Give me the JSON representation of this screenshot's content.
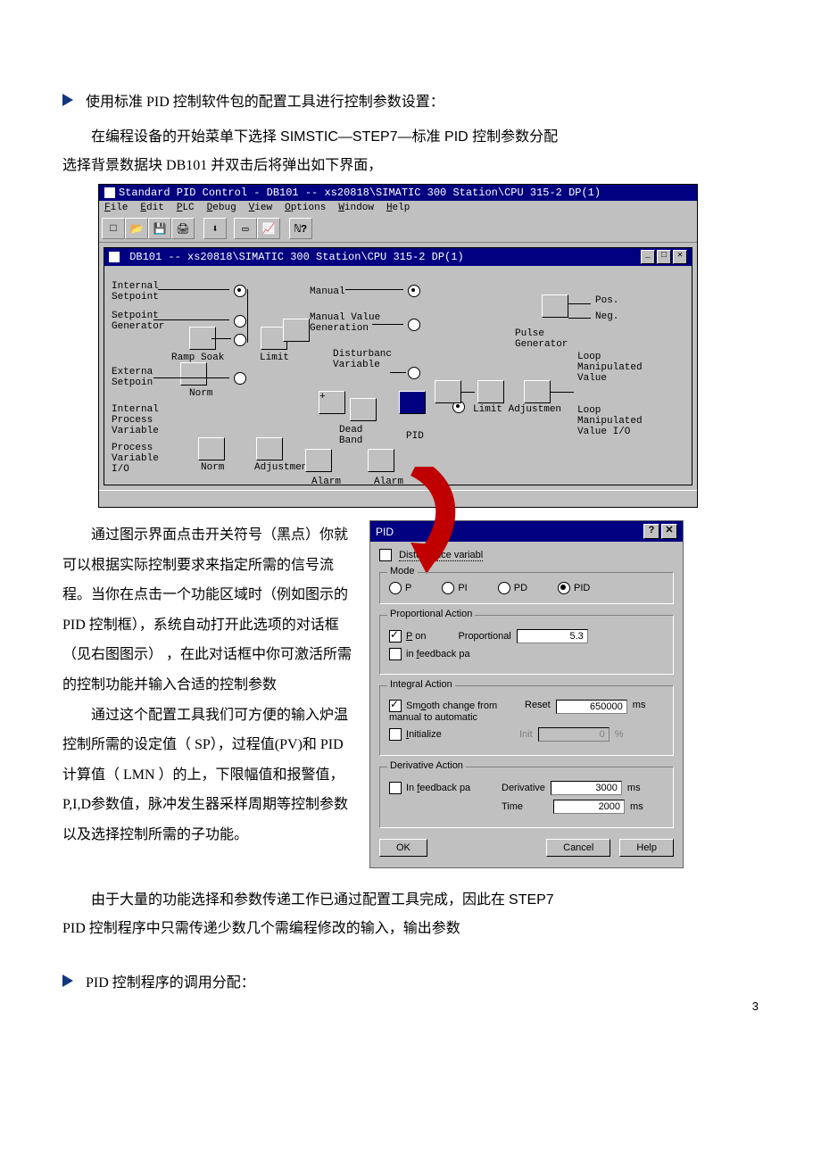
{
  "intro": {
    "bullet1": "使用标准 PID 控制软件包的配置工具进行控制参数设置：",
    "p1_a": "在编程设备的开始菜单下选择 ",
    "p1_b": "SIMSTIC—STEP7—标准 PID 控制参数分配",
    "p2_a": "选择背景数据块 ",
    "p2_b": "DB101 并双击后将弹出如下界面，"
  },
  "win": {
    "title_prefix": "Standard PID Control - DB101 -- xs20818\\SIMATIC 300 Station\\CPU 315-2 DP(1)",
    "menus": {
      "file": "File",
      "edit": "Edit",
      "plc": "PLC",
      "debug": "Debug",
      "view": "View",
      "options": "Options",
      "window": "Window",
      "help": "Help"
    },
    "inner_title": "DB101 -- xs20818\\SIMATIC 300 Station\\CPU 315-2 DP(1)",
    "labels": {
      "internal_setpoint": "Internal\nSetpoint",
      "setpoint_generator": "Setpoint\nGenerator",
      "ramp_soak": "Ramp Soak",
      "externa_setpoint": "Externa\nSetpoin",
      "norm": "Norm",
      "limit": "Limit",
      "manual": "Manual",
      "manual_value_gen": "Manual Value\nGeneration",
      "disturbance_variable": "Disturbanc\nVariable",
      "internal_pv": "Internal\nProcess\nVariable",
      "process_io": "Process\nVariable\nI/O",
      "adjustmen": "Adjustmen",
      "alarm": "Alarm",
      "dead_band": "Dead\nBand",
      "pid": "PID",
      "limit_adjustmen": "Limit Adjustmen",
      "pos": "Pos.",
      "neg": "Neg.",
      "pulse_generator": "Pulse\nGenerator",
      "loop_manip_value": "Loop\nManipulated\nValue",
      "loop_manip_io": "Loop\nManipulated\nValue I/O"
    }
  },
  "mid": {
    "p1": "通过图示界面点击开关符号（黑点）你就可以根据实际控制要求来指定所需的信号流程。当你在点击一个功能区域时（例如图示的 PID 控制框），系统自动打开此选项的对话框（见右图图示） ，在此对话框中你可激活所需的控制功能并输入合适的控制参数",
    "p2": "通过这个配置工具我们可方便的输入炉温控制所需的设定值（ SP），过程值(PV)和 PID 计算值（ LMN ）的上，下限幅值和报警值， P,I,D参数值，脉冲发生器采样周期等控制参数以及选择控制所需的子功能。"
  },
  "dlg": {
    "title": "PID",
    "disturbance": "Disturbance variabl",
    "mode_title": "Mode",
    "modes": {
      "p": "P",
      "pi": "PI",
      "pd": "PD",
      "pid": "PID"
    },
    "p_action_title": "Proportional Action",
    "p_on": "P on",
    "p_label": "Proportional",
    "p_value": "5.3",
    "p_feedback": "in feedback pa",
    "i_action_title": "Integral Action",
    "i_smooth": "Smooth change from manual to automatic",
    "i_reset": "Reset",
    "i_reset_value": "650000",
    "i_reset_unit": "ms",
    "i_initialize": "Initialize",
    "i_init": "Init",
    "i_init_value": "0",
    "i_init_unit": "%",
    "d_action_title": "Derivative Action",
    "d_feedback": "In feedback pa",
    "d_deriv": "Derivative",
    "d_deriv_value": "3000",
    "d_deriv_unit": "ms",
    "d_time": "Time",
    "d_time_value": "2000",
    "d_time_unit": "ms",
    "btn_ok": "OK",
    "btn_cancel": "Cancel",
    "btn_help": "Help"
  },
  "tail": {
    "p1a": "由于大量的功能选择和参数传递工作已通过配置工具完成，因此在 ",
    "p1b": "STEP7",
    "p2": "PID 控制程序中只需传递少数几个需编程修改的输入，输出参数",
    "bullet2": "PID 控制程序的调用分配："
  },
  "page_no": "3"
}
